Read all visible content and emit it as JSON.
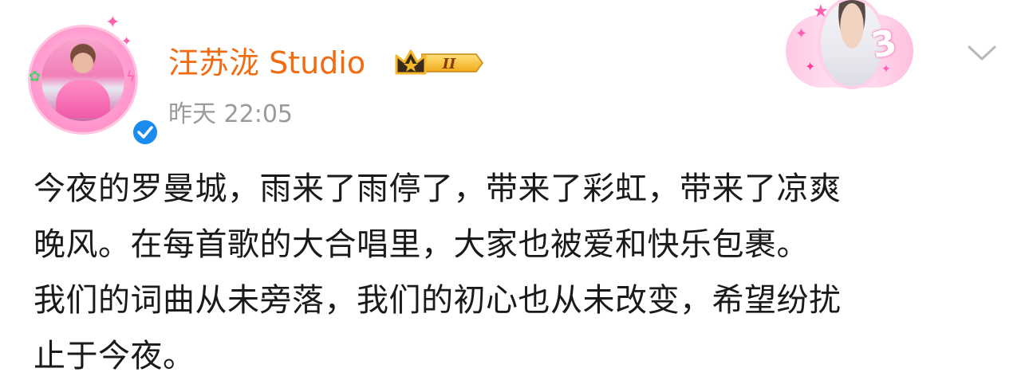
{
  "post": {
    "author": "汪苏泷 Studio",
    "timestamp": "昨天  22:05",
    "vip_level": "II",
    "card_number": "3",
    "lines": [
      "今夜的罗曼城，雨来了雨停了，带来了彩虹，带来了凉爽",
      "晚风。在每首歌的大合唱里，大家也被爱和快乐包裹。",
      "我们的词曲从未旁落，我们的初心也从未改变，希望纷扰",
      "止于今夜。"
    ]
  },
  "colors": {
    "author": "#f26b10",
    "timestamp": "#9a9a9a",
    "body_text": "#1a1a1a",
    "verified": "#1a8cf0",
    "vip_gold": "#f3b72b"
  },
  "icons": {
    "verified": "verified-check-icon",
    "vip": "crown-vip-badge-icon",
    "more": "chevron-down-icon"
  }
}
